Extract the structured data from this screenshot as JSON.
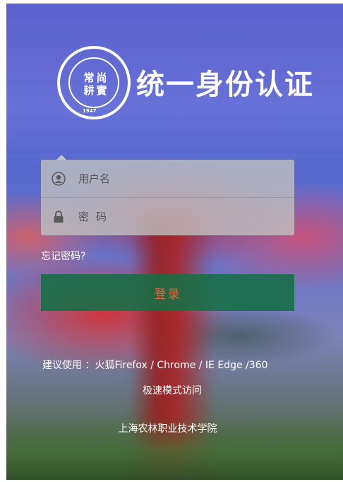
{
  "header": {
    "title": "统一身份认证",
    "logo_text": [
      "常",
      "尚",
      "耕",
      "實"
    ],
    "logo_year": "1947"
  },
  "login": {
    "username_placeholder": "用户名",
    "password_placeholder": "密码",
    "forgot_label": "忘记密码?",
    "submit_label": "登录"
  },
  "notice": {
    "line1": "建议使用 ：火狐Firefox / Chrome / IE Edge /360",
    "line2": "极速模式访问"
  },
  "footer": {
    "school_name": "上海农林职业技术学院"
  },
  "colors": {
    "login_button_bg": "#146e46",
    "login_button_text": "#e06b3c",
    "card_bg": "#bebebe"
  },
  "icons": {
    "username": "user-icon",
    "password": "lock-icon"
  }
}
